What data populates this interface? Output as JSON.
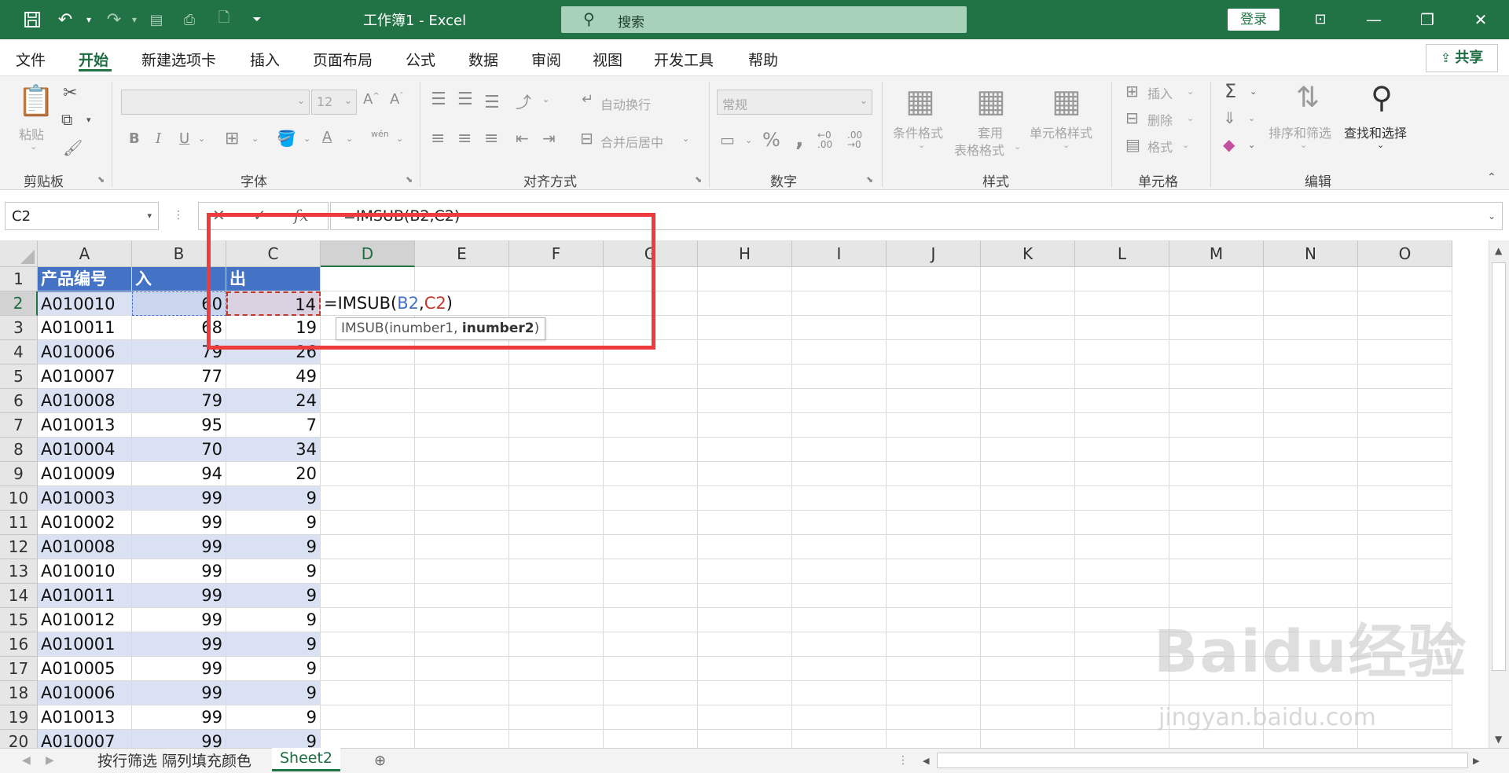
{
  "titlebar": {
    "title": "工作簿1  -  Excel",
    "search_placeholder": "搜索",
    "login": "登录"
  },
  "menu": {
    "items": [
      "文件",
      "开始",
      "新建选项卡",
      "插入",
      "页面布局",
      "公式",
      "数据",
      "审阅",
      "视图",
      "开发工具",
      "帮助"
    ],
    "active": "开始",
    "share": "共享"
  },
  "ribbon": {
    "clipboard": {
      "label": "剪贴板",
      "paste": "粘贴"
    },
    "font": {
      "label": "字体",
      "size": "12",
      "bold": "B",
      "italic": "I",
      "underline": "U",
      "wen": "wén"
    },
    "alignment": {
      "label": "对齐方式",
      "wrap": "自动换行",
      "merge": "合并后居中"
    },
    "number": {
      "label": "数字",
      "format": "常规",
      "percent": "%",
      "comma": ","
    },
    "styles": {
      "label": "样式",
      "conditional": "条件格式",
      "table_format_1": "套用",
      "table_format_2": "表格格式",
      "cell_styles": "单元格样式"
    },
    "cells": {
      "label": "单元格",
      "insert": "插入",
      "delete": "删除",
      "format": "格式"
    },
    "editing": {
      "label": "编辑",
      "sort": "排序和筛选",
      "find": "查找和选择"
    }
  },
  "formula_bar": {
    "name_box": "C2",
    "formula": "=IMSUB(B2,C2)",
    "fx": "fx"
  },
  "grid": {
    "columns": [
      "A",
      "B",
      "C",
      "D",
      "E",
      "F",
      "G",
      "H",
      "I",
      "J",
      "K",
      "L",
      "M",
      "N",
      "O"
    ],
    "selected_column": "D",
    "selected_row": "2",
    "header_row": [
      "产品编号",
      "入",
      "出"
    ],
    "rows": [
      [
        "A010010",
        "60",
        "14"
      ],
      [
        "A010011",
        "68",
        "19"
      ],
      [
        "A010006",
        "79",
        "26"
      ],
      [
        "A010007",
        "77",
        "49"
      ],
      [
        "A010008",
        "79",
        "24"
      ],
      [
        "A010013",
        "95",
        "7"
      ],
      [
        "A010004",
        "70",
        "34"
      ],
      [
        "A010009",
        "94",
        "20"
      ],
      [
        "A010003",
        "99",
        "9"
      ],
      [
        "A010002",
        "99",
        "9"
      ],
      [
        "A010008",
        "99",
        "9"
      ],
      [
        "A010010",
        "99",
        "9"
      ],
      [
        "A010011",
        "99",
        "9"
      ],
      [
        "A010012",
        "99",
        "9"
      ],
      [
        "A010001",
        "99",
        "9"
      ],
      [
        "A010005",
        "99",
        "9"
      ],
      [
        "A010006",
        "99",
        "9"
      ],
      [
        "A010013",
        "99",
        "9"
      ],
      [
        "A010007",
        "99",
        "9"
      ]
    ],
    "row_numbers": [
      "1",
      "2",
      "3",
      "4",
      "5",
      "6",
      "7",
      "8",
      "9",
      "10",
      "11",
      "12",
      "13",
      "14",
      "15",
      "16",
      "17",
      "18",
      "19",
      "20"
    ],
    "edit_cell": {
      "prefix": "=IMSUB(",
      "ref1": "B2",
      "comma": ",",
      "ref2": "C2",
      "suffix": ")"
    },
    "tooltip": {
      "fn": "IMSUB(inumber1, ",
      "bold_arg": "inumber2",
      "close": ")"
    }
  },
  "sheets": {
    "tabs": [
      "按行筛选 隔列填充颜色",
      "Sheet2"
    ],
    "active": "Sheet2"
  },
  "colors": {
    "excel_green": "#217346",
    "header_blue": "#4472c4",
    "band_blue": "#d9e1f2",
    "annotation_red": "#ee3b3b",
    "ref1_color": "#4472c4",
    "ref2_color": "#c0392b"
  },
  "watermark": {
    "brand": "Bai",
    "brand2": "du",
    "cn": "经验",
    "url": "jingyan.baidu.com"
  }
}
